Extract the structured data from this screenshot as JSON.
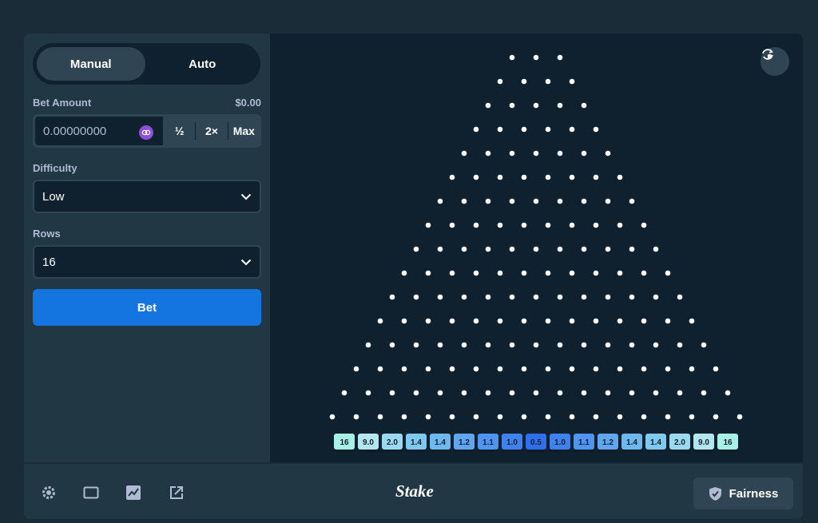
{
  "sidebar": {
    "mode_tabs": [
      {
        "label": "Manual",
        "active": true
      },
      {
        "label": "Auto",
        "active": false
      }
    ],
    "bet_amount_label": "Bet Amount",
    "bet_amount_usd": "$0.00",
    "bet_amount_value": "0.00000000",
    "half_label": "½",
    "double_label": "2×",
    "max_label": "Max",
    "difficulty_label": "Difficulty",
    "difficulty_value": "Low",
    "rows_label": "Rows",
    "rows_value": "16",
    "bet_button_label": "Bet"
  },
  "board": {
    "peg_rows": 16,
    "multipliers": [
      "16",
      "9.0",
      "2.0",
      "1.4",
      "1.4",
      "1.2",
      "1.1",
      "1.0",
      "0.5",
      "1.0",
      "1.1",
      "1.2",
      "1.4",
      "1.4",
      "2.0",
      "9.0",
      "16"
    ],
    "bucket_colors": [
      "#a7f0e8",
      "#b3e6ee",
      "#9ad9ee",
      "#7fc8ee",
      "#6fb8ee",
      "#5fa6ee",
      "#4f94ee",
      "#3f82ee",
      "#2f6fee",
      "#3f82ee",
      "#4f94ee",
      "#5fa6ee",
      "#6fb8ee",
      "#7fc8ee",
      "#9ad9ee",
      "#b3e6ee",
      "#a7f0e8"
    ]
  },
  "footer": {
    "logo_text": "Stake",
    "fairness_label": "Fairness"
  }
}
